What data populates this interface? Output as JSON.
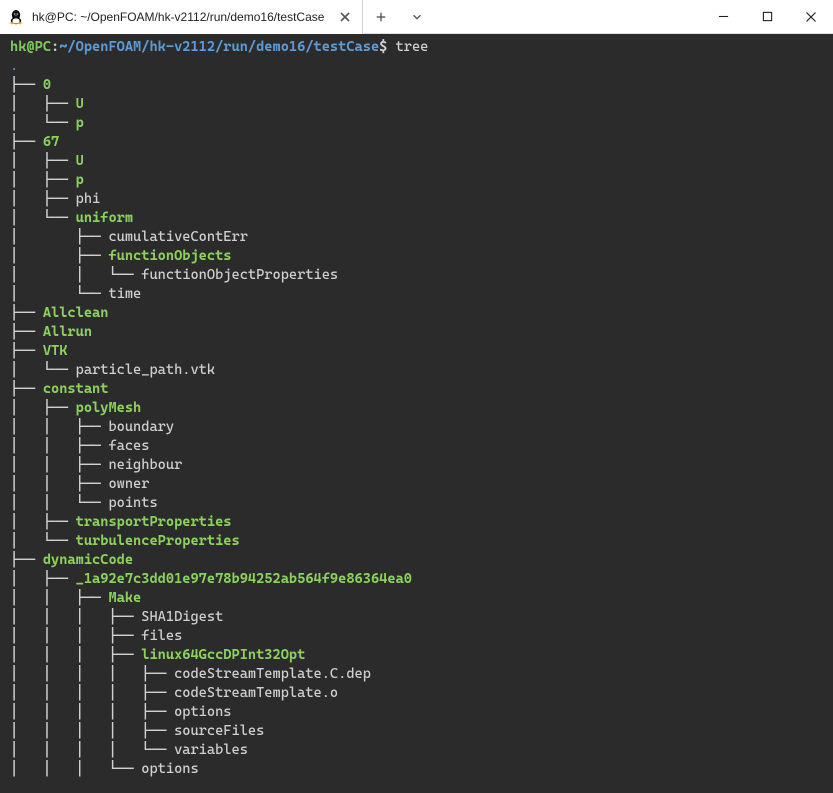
{
  "tab": {
    "title": "hk@PC: ~/OpenFOAM/hk-v2112/run/demo16/testCase"
  },
  "prompt": {
    "userhost": "hk@PC",
    "sep1": ":",
    "path": "~/OpenFOAM/hk-v2112/run/demo16/testCase",
    "sep2": "$"
  },
  "command": "tree",
  "dot": ".",
  "tree": [
    {
      "prefix": "├── ",
      "name": "0",
      "cls": "dir"
    },
    {
      "prefix": "│   ├── ",
      "name": "U",
      "cls": "exe"
    },
    {
      "prefix": "│   └── ",
      "name": "p",
      "cls": "exe"
    },
    {
      "prefix": "├── ",
      "name": "67",
      "cls": "dir"
    },
    {
      "prefix": "│   ├── ",
      "name": "U",
      "cls": "exe"
    },
    {
      "prefix": "│   ├── ",
      "name": "p",
      "cls": "exe"
    },
    {
      "prefix": "│   ├── ",
      "name": "phi",
      "cls": "file"
    },
    {
      "prefix": "│   └── ",
      "name": "uniform",
      "cls": "dir"
    },
    {
      "prefix": "│       ├── ",
      "name": "cumulativeContErr",
      "cls": "file"
    },
    {
      "prefix": "│       ├── ",
      "name": "functionObjects",
      "cls": "dir"
    },
    {
      "prefix": "│       │   └── ",
      "name": "functionObjectProperties",
      "cls": "file"
    },
    {
      "prefix": "│       └── ",
      "name": "time",
      "cls": "file"
    },
    {
      "prefix": "├── ",
      "name": "Allclean",
      "cls": "exe"
    },
    {
      "prefix": "├── ",
      "name": "Allrun",
      "cls": "exe"
    },
    {
      "prefix": "├── ",
      "name": "VTK",
      "cls": "dir"
    },
    {
      "prefix": "│   └── ",
      "name": "particle_path.vtk",
      "cls": "file"
    },
    {
      "prefix": "├── ",
      "name": "constant",
      "cls": "dir"
    },
    {
      "prefix": "│   ├── ",
      "name": "polyMesh",
      "cls": "dir"
    },
    {
      "prefix": "│   │   ├── ",
      "name": "boundary",
      "cls": "file"
    },
    {
      "prefix": "│   │   ├── ",
      "name": "faces",
      "cls": "file"
    },
    {
      "prefix": "│   │   ├── ",
      "name": "neighbour",
      "cls": "file"
    },
    {
      "prefix": "│   │   ├── ",
      "name": "owner",
      "cls": "file"
    },
    {
      "prefix": "│   │   └── ",
      "name": "points",
      "cls": "file"
    },
    {
      "prefix": "│   ├── ",
      "name": "transportProperties",
      "cls": "exe"
    },
    {
      "prefix": "│   └── ",
      "name": "turbulenceProperties",
      "cls": "exe"
    },
    {
      "prefix": "├── ",
      "name": "dynamicCode",
      "cls": "dir"
    },
    {
      "prefix": "│   ├── ",
      "name": "_1a92e7c3dd01e97e78b94252ab564f9e86364ea0",
      "cls": "dir"
    },
    {
      "prefix": "│   │   ├── ",
      "name": "Make",
      "cls": "dir"
    },
    {
      "prefix": "│   │   │   ├── ",
      "name": "SHA1Digest",
      "cls": "file"
    },
    {
      "prefix": "│   │   │   ├── ",
      "name": "files",
      "cls": "file"
    },
    {
      "prefix": "│   │   │   ├── ",
      "name": "linux64GccDPInt32Opt",
      "cls": "dir"
    },
    {
      "prefix": "│   │   │   │   ├── ",
      "name": "codeStreamTemplate.C.dep",
      "cls": "file"
    },
    {
      "prefix": "│   │   │   │   ├── ",
      "name": "codeStreamTemplate.o",
      "cls": "file"
    },
    {
      "prefix": "│   │   │   │   ├── ",
      "name": "options",
      "cls": "file"
    },
    {
      "prefix": "│   │   │   │   ├── ",
      "name": "sourceFiles",
      "cls": "file"
    },
    {
      "prefix": "│   │   │   │   └── ",
      "name": "variables",
      "cls": "file"
    },
    {
      "prefix": "│   │   │   └── ",
      "name": "options",
      "cls": "file"
    }
  ]
}
